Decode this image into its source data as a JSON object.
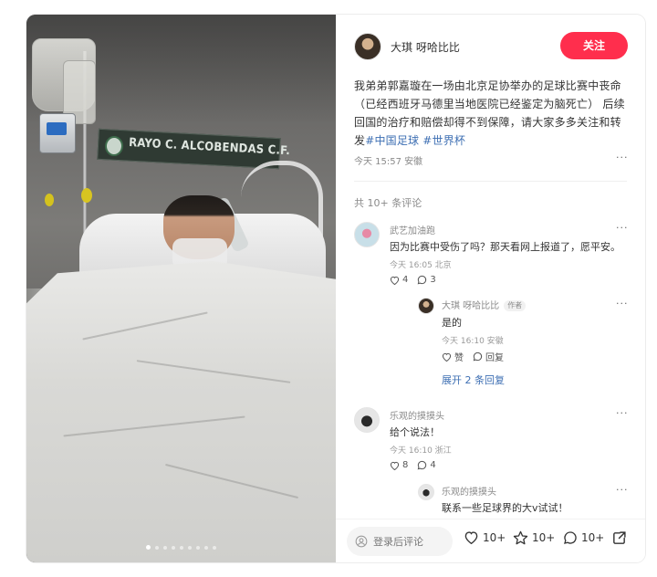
{
  "author": {
    "name": "大琪 呀哈比比",
    "follow_label": "关注"
  },
  "post": {
    "text": "我弟弟郭嘉璇在一场由北京足协举办的足球比赛中丧命（已经西班牙马德里当地医院已经鉴定为脑死亡） 后续回国的治疗和赔偿却得不到保障，请大家多多关注和转发",
    "tags": [
      "#中国足球",
      "#世界杯"
    ],
    "time": "今天 15:57 安徽",
    "more": "···"
  },
  "photo": {
    "banner_text": "RAYO C. ALCOBENDAS C.F.",
    "dots_total": 9,
    "dots_active": 0
  },
  "comments": {
    "count_label": "共 10+ 条评论",
    "items": [
      {
        "name": "武艺加油跑",
        "text": "因为比赛中受伤了吗？那天看网上报道了，愿平安。",
        "meta": "今天 16:05 北京",
        "likes": "4",
        "replies": "3"
      },
      {
        "name": "乐观的摸摸头",
        "text": "给个说法！",
        "meta": "今天 16:10 浙江",
        "likes": "8",
        "replies": "4"
      }
    ],
    "reply": {
      "name": "大琪 呀哈比比",
      "badge": "作者",
      "text": "是的",
      "meta": "今天 16:10 安徽",
      "like_label": "赞",
      "reply_label": "回复"
    },
    "expand_label": "展开 2 条回复",
    "reply2": {
      "name": "乐观的摸摸头",
      "text": "联系一些足球界的大v试试！"
    }
  },
  "bottom": {
    "comment_placeholder": "登录后评论",
    "likes": "10+",
    "stars": "10+",
    "comments": "10+"
  },
  "colors": {
    "accent": "#ff2e4d",
    "tag": "#3e6fb3"
  }
}
